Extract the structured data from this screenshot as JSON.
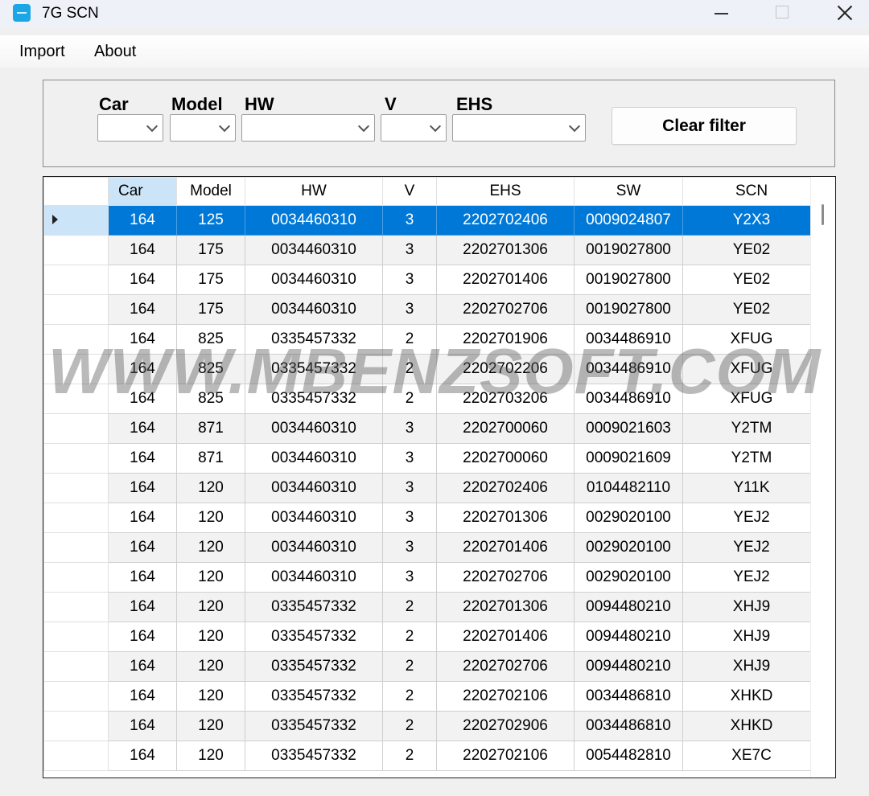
{
  "window": {
    "title": "7G SCN"
  },
  "menu": {
    "items": [
      "Import",
      "About"
    ]
  },
  "filters": {
    "labels": [
      "Car",
      "Model",
      "HW",
      "V",
      "EHS"
    ],
    "clear_label": "Clear filter"
  },
  "grid": {
    "columns": [
      "Car",
      "Model",
      "HW",
      "V",
      "EHS",
      "SW",
      "SCN"
    ],
    "sorted_column": "Car",
    "selected_row": 0,
    "rows": [
      [
        "164",
        "125",
        "0034460310",
        "3",
        "2202702406",
        "0009024807",
        "Y2X3"
      ],
      [
        "164",
        "175",
        "0034460310",
        "3",
        "2202701306",
        "0019027800",
        "YE02"
      ],
      [
        "164",
        "175",
        "0034460310",
        "3",
        "2202701406",
        "0019027800",
        "YE02"
      ],
      [
        "164",
        "175",
        "0034460310",
        "3",
        "2202702706",
        "0019027800",
        "YE02"
      ],
      [
        "164",
        "825",
        "0335457332",
        "2",
        "2202701906",
        "0034486910",
        "XFUG"
      ],
      [
        "164",
        "825",
        "0335457332",
        "2",
        "2202702206",
        "0034486910",
        "XFUG"
      ],
      [
        "164",
        "825",
        "0335457332",
        "2",
        "2202703206",
        "0034486910",
        "XFUG"
      ],
      [
        "164",
        "871",
        "0034460310",
        "3",
        "2202700060",
        "0009021603",
        "Y2TM"
      ],
      [
        "164",
        "871",
        "0034460310",
        "3",
        "2202700060",
        "0009021609",
        "Y2TM"
      ],
      [
        "164",
        "120",
        "0034460310",
        "3",
        "2202702406",
        "0104482110",
        "Y11K"
      ],
      [
        "164",
        "120",
        "0034460310",
        "3",
        "2202701306",
        "0029020100",
        "YEJ2"
      ],
      [
        "164",
        "120",
        "0034460310",
        "3",
        "2202701406",
        "0029020100",
        "YEJ2"
      ],
      [
        "164",
        "120",
        "0034460310",
        "3",
        "2202702706",
        "0029020100",
        "YEJ2"
      ],
      [
        "164",
        "120",
        "0335457332",
        "2",
        "2202701306",
        "0094480210",
        "XHJ9"
      ],
      [
        "164",
        "120",
        "0335457332",
        "2",
        "2202701406",
        "0094480210",
        "XHJ9"
      ],
      [
        "164",
        "120",
        "0335457332",
        "2",
        "2202702706",
        "0094480210",
        "XHJ9"
      ],
      [
        "164",
        "120",
        "0335457332",
        "2",
        "2202702106",
        "0034486810",
        "XHKD"
      ],
      [
        "164",
        "120",
        "0335457332",
        "2",
        "2202702906",
        "0034486810",
        "XHKD"
      ],
      [
        "164",
        "120",
        "0335457332",
        "2",
        "2202702106",
        "0054482810",
        "XE7C"
      ]
    ]
  },
  "watermark": "WWW.MBENZSOFT.COM",
  "colors": {
    "selection": "#0078d7",
    "sorted_header": "#cce4f7",
    "app_icon": "#1ba7e6"
  }
}
